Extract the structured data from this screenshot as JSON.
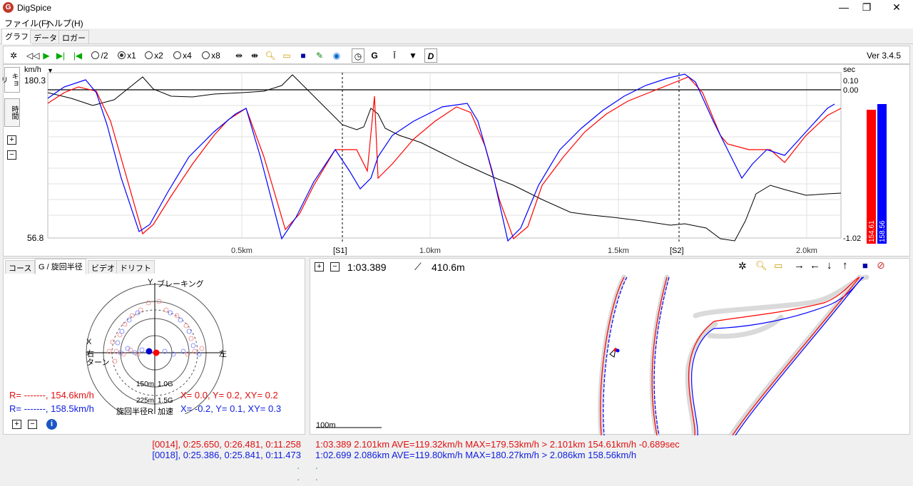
{
  "window": {
    "title": "DigSpice",
    "minimize": "—",
    "restore": "❐",
    "close": "✕"
  },
  "menu": [
    "ファイル(F)",
    "ヘルプ(H)"
  ],
  "main_tabs": [
    "グラフ",
    "データ",
    "ロガー"
  ],
  "toolbar": {
    "speeds": [
      "/2",
      "x1",
      "x2",
      "x4",
      "x8"
    ],
    "selected_speed": "x1",
    "version": "Ver 3.4.5"
  },
  "graph": {
    "side_tabs": [
      "キョリ",
      "時間"
    ],
    "y_unit": "km/h",
    "y_max": "180.3",
    "y_min": "56.8",
    "sec_unit": "sec",
    "sec_ticks": [
      "0.10",
      "0.00",
      "-1.02"
    ],
    "x_ticks": [
      "0.5km",
      "1.0km",
      "1.5km",
      "2.0km"
    ],
    "sectors": [
      "[S1]",
      "[S2]"
    ],
    "bar_red_value": "154.61",
    "bar_blue_value": "158.56",
    "colors": {
      "red": "#ff0000",
      "blue": "#0000ff",
      "delta": "#000000"
    }
  },
  "gpanel": {
    "tabs": [
      "コース",
      "G / 旋回半径",
      "ビデオ",
      "ドリフト"
    ],
    "y_label": "Y",
    "brake_label": "ブレーキング",
    "x_label": "X",
    "right_turn": "右",
    "turn": "ターン",
    "left_label": "左",
    "ring_150": "150m",
    "ring_1g": "1.0G",
    "ring_225": "225m",
    "ring_15g": "1.5G",
    "radius_label": "旋回半径R",
    "accel_label": "加速",
    "red_r": "R= -------, 154.6km/h",
    "red_xy": "X=  0.0, Y=  0.2, XY= 0.2",
    "blue_r": "R= -------, 158.5km/h",
    "blue_xy": "X= -0.2, Y=  0.1, XY= 0.3"
  },
  "map": {
    "time": "1:03.389",
    "distance": "410.6m",
    "scale": "100m"
  },
  "status": {
    "left_red": "[0014], 0:25.650, 0:26.481, 0:11.258",
    "left_blue": "[0018], 0:25.386, 0:25.841, 0:11.473",
    "right_red": "1:03.389 2.101km AVE=119.32km/h MAX=179.53km/h > 2.101km 154.61km/h -0.689sec",
    "right_blue": "1:02.699 2.086km AVE=119.80km/h MAX=180.27km/h > 2.086km 158.56km/h",
    "dot": "."
  }
}
